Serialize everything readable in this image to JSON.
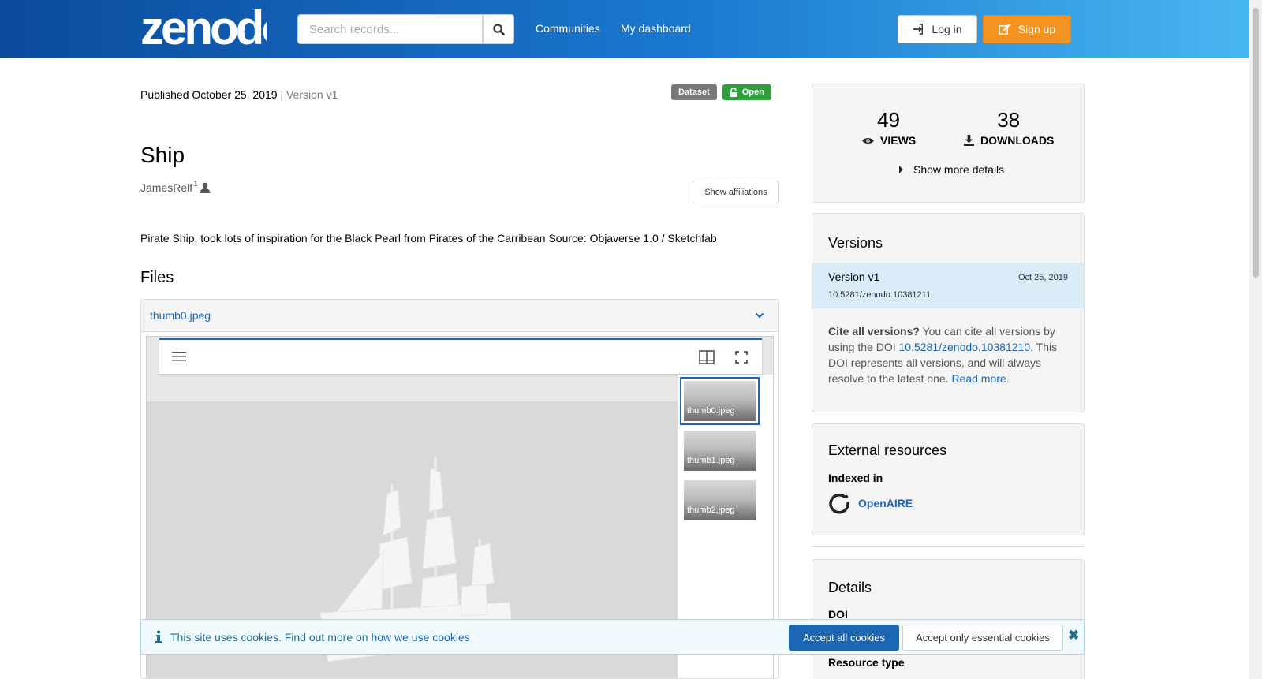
{
  "header": {
    "logo_text": "zenodo",
    "search_placeholder": "Search records...",
    "nav": [
      "Communities",
      "My dashboard"
    ],
    "login_label": "Log in",
    "signup_label": "Sign up"
  },
  "record": {
    "published": "Published October 25, 2019",
    "version": "| Version v1",
    "badge_type": "Dataset",
    "badge_access": "Open",
    "title": "Ship",
    "author": "JamesRelf",
    "author_sup": "1",
    "show_affiliations": "Show affiliations",
    "description": "Pirate Ship, took lots of inspiration for the Black Pearl from Pirates of the Carribean Source: Objaverse 1.0 / Sketchfab"
  },
  "files": {
    "heading": "Files",
    "file_name": "thumb0.jpeg",
    "thumbnails": [
      "thumb0.jpeg",
      "thumb1.jpeg",
      "thumb2.jpeg"
    ],
    "selected_index": 0
  },
  "stats": {
    "views": "49",
    "views_label": "VIEWS",
    "downloads": "38",
    "downloads_label": "DOWNLOADS",
    "more_details": "Show more details"
  },
  "versions": {
    "heading": "Versions",
    "items": [
      {
        "label": "Version v1",
        "date": "Oct 25, 2019",
        "doi": "10.5281/zenodo.10381211"
      }
    ],
    "cite_bold": "Cite all versions?",
    "cite_text1": " You can cite all versions by using the DOI ",
    "cite_doi": "10.5281/zenodo.10381210",
    "cite_text2": ". This DOI represents all versions, and will always resolve to the latest one. ",
    "read_more": "Read more."
  },
  "external": {
    "heading": "External resources",
    "indexed_in": "Indexed in",
    "openaire": "OpenAIRE"
  },
  "details": {
    "heading": "Details",
    "doi_label": "DOI",
    "resource_type_label": "Resource type"
  },
  "cookie": {
    "text": "This site uses cookies. Find out more on ",
    "link": "how we use cookies",
    "accept_all": "Accept all cookies",
    "accept_essential": "Accept only essential cookies"
  },
  "colors": {
    "brand_blue": "#1c66b4",
    "signup_orange": "#f49321",
    "open_green": "#2e9f3c"
  }
}
